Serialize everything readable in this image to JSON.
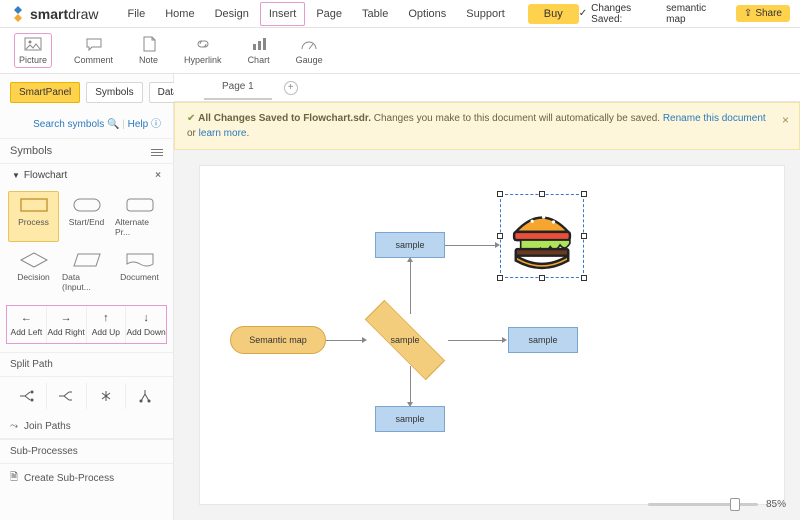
{
  "brand": {
    "name_a": "smart",
    "name_b": "draw"
  },
  "menu": {
    "items": [
      "File",
      "Home",
      "Design",
      "Insert",
      "Page",
      "Table",
      "Options",
      "Support"
    ],
    "highlighted": "Insert",
    "buy": "Buy"
  },
  "status": {
    "saved_label": "Changes Saved:",
    "doc_name": "semantic map",
    "share": "Share"
  },
  "ribbon": {
    "items": [
      {
        "label": "Picture",
        "icon": "picture-icon",
        "active": true
      },
      {
        "label": "Comment",
        "icon": "comment-icon",
        "active": false
      },
      {
        "label": "Note",
        "icon": "note-icon",
        "active": false
      },
      {
        "label": "Hyperlink",
        "icon": "hyperlink-icon",
        "active": false
      },
      {
        "label": "Chart",
        "icon": "chart-icon",
        "active": false
      },
      {
        "label": "Gauge",
        "icon": "gauge-icon",
        "active": false
      }
    ]
  },
  "side": {
    "tabs": [
      "SmartPanel",
      "Symbols",
      "Data"
    ],
    "active_tab": "SmartPanel",
    "search_label": "Search symbols",
    "help_label": "Help",
    "symbols_head": "Symbols",
    "group_name": "Flowchart",
    "shapes": [
      {
        "label": "Process",
        "kind": "rect",
        "selected": true
      },
      {
        "label": "Start/End",
        "kind": "pill",
        "selected": false
      },
      {
        "label": "Alternate Pr...",
        "kind": "roundrect",
        "selected": false
      },
      {
        "label": "Decision",
        "kind": "diamond",
        "selected": false
      },
      {
        "label": "Data (Input...",
        "kind": "parallelogram",
        "selected": false
      },
      {
        "label": "Document",
        "kind": "document",
        "selected": false
      }
    ],
    "quick": [
      "Add Left",
      "Add Right",
      "Add Up",
      "Add Down"
    ],
    "split_path": "Split Path",
    "join_paths": "Join Paths",
    "sub_head": "Sub-Processes",
    "create_sub": "Create Sub-Process"
  },
  "canvas": {
    "page_tab": "Page 1",
    "banner_bold": "All Changes Saved to Flowchart.sdr.",
    "banner_text": " Changes you make to this document will automatically be saved. ",
    "banner_rename": "Rename this document",
    "banner_or": " or ",
    "banner_learn": "learn more",
    "nodes": {
      "start": "Semantic map",
      "top": "sample",
      "mid": "sample",
      "right": "sample",
      "bottom": "sample"
    },
    "zoom": {
      "percent": "85%",
      "value": 85
    }
  }
}
